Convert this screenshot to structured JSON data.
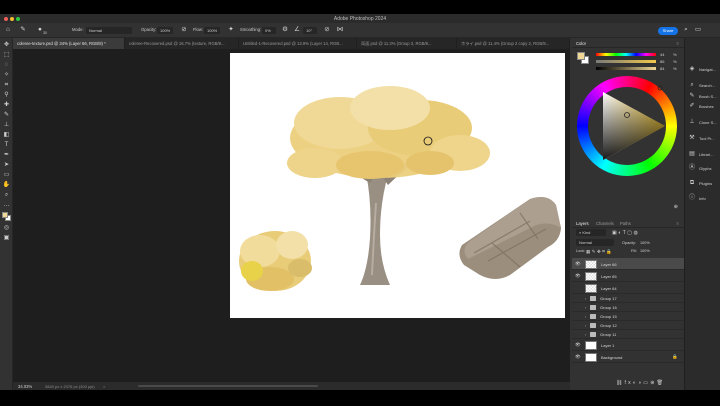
{
  "app": {
    "title": "Adobe Photoshop 2024"
  },
  "options": {
    "brush_size": "30",
    "mode_label": "Mode:",
    "mode_value": "Normal",
    "opacity_label": "Opacity:",
    "opacity_value": "100%",
    "flow_label": "Flow:",
    "flow_value": "100%",
    "smoothing_label": "Smoothing:",
    "smoothing_value": "0%",
    "angle_value": "10°",
    "share_label": "Share"
  },
  "tabs": [
    "coleree-texture.psd @ 34% (Layer 66, RGB/8) *",
    "coleree-Recovered.psd @ 16.7% (texture, RGB/8...",
    "Untitled-1-Recovered.psd @ 13.9% (Layer 14, RGB...",
    "両面.psd @ 11.3% (Group 3, RGB/8...",
    "ホライ.psd @ 11.4% (Group 2 copy 2, RGB/8..."
  ],
  "status": {
    "zoom": "34.03%",
    "info": "3840 px x 2376 px (300 ppi)",
    "arrow": ">"
  },
  "color_panel": {
    "title": "Color",
    "slider_values": [
      "44",
      "86",
      "84"
    ],
    "unit": "%"
  },
  "layers_panel": {
    "tabs": [
      "Layers",
      "Channels",
      "Paths"
    ],
    "filter_label": "Kind",
    "blend_mode": "Normal",
    "opacity_label": "Opacity:",
    "opacity_value": "100%",
    "lock_label": "Lock:",
    "fill_label": "Fill:",
    "fill_value": "100%",
    "layers": [
      {
        "name": "Layer 66",
        "type": "layer",
        "visible": true,
        "selected": true
      },
      {
        "name": "Layer 65",
        "type": "layer",
        "visible": true
      },
      {
        "name": "Layer 64",
        "type": "layer",
        "visible": false
      },
      {
        "name": "Group 17",
        "type": "group"
      },
      {
        "name": "Group 16",
        "type": "group"
      },
      {
        "name": "Group 15",
        "type": "group"
      },
      {
        "name": "Group 12",
        "type": "group"
      },
      {
        "name": "Group 11",
        "type": "group"
      },
      {
        "name": "Layer 1",
        "type": "layer",
        "visible": true
      },
      {
        "name": "Background",
        "type": "background",
        "visible": true
      }
    ]
  },
  "dock": [
    {
      "label": "Navigat...",
      "icon": "navigator-icon"
    },
    {
      "label": "Search...",
      "icon": "search-icon"
    },
    {
      "label": "Brush S...",
      "icon": "brush-settings-icon"
    },
    {
      "label": "Brushes",
      "icon": "brushes-icon"
    },
    {
      "label": "Clone S...",
      "icon": "clone-source-icon"
    },
    {
      "label": "Tool Pr...",
      "icon": "tool-presets-icon"
    },
    {
      "label": "Librari...",
      "icon": "libraries-icon"
    },
    {
      "label": "Glyphs",
      "icon": "glyphs-icon"
    },
    {
      "label": "Plugins",
      "icon": "plugins-icon"
    },
    {
      "label": "Info",
      "icon": "info-icon"
    }
  ],
  "colors": {
    "foreground": "#f0d896",
    "background": "#ffffff",
    "accent": "#1473e6",
    "foliage": "#eccf7c",
    "trunk": "#9a8f83",
    "rock": "#9b8e7d"
  }
}
